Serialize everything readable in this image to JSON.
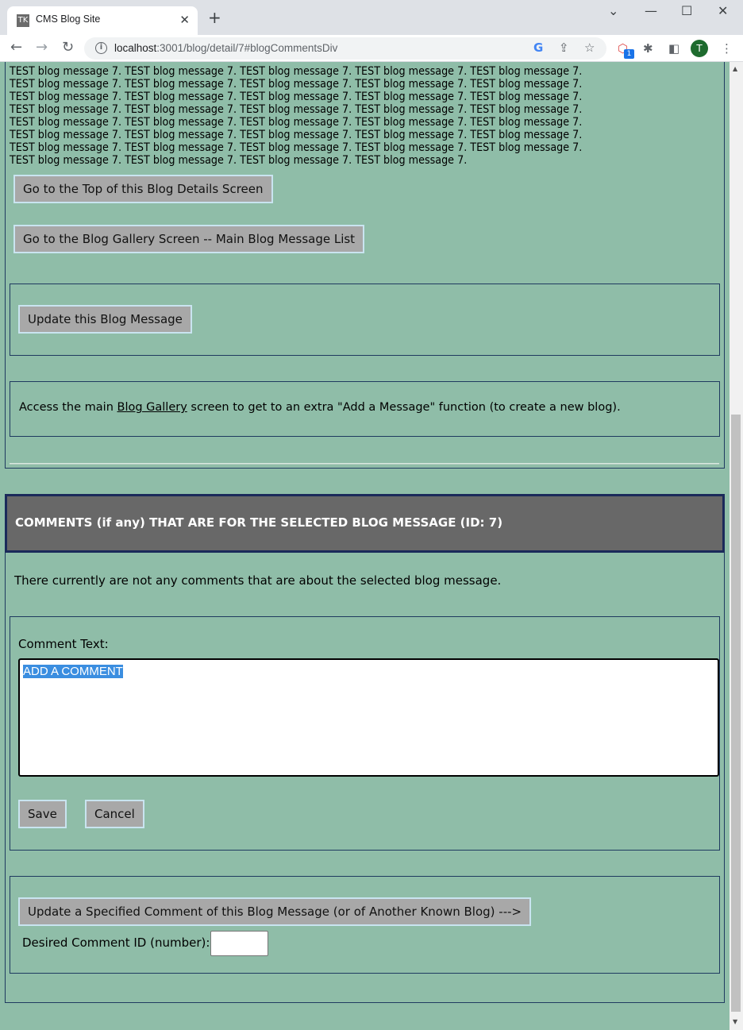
{
  "browser": {
    "tab_title": "CMS Blog Site",
    "favicon_text": "TK",
    "url_host": "localhost",
    "url_rest": ":3001/blog/detail/7#blogCommentsDiv",
    "profile_initial": "T",
    "extension_badge": "1"
  },
  "blog": {
    "message_lines": [
      "TEST blog message 7. TEST blog message 7. TEST blog message 7. TEST blog message 7. TEST blog message 7.",
      "TEST blog message 7. TEST blog message 7. TEST blog message 7. TEST blog message 7. TEST blog message 7.",
      "TEST blog message 7. TEST blog message 7. TEST blog message 7. TEST blog message 7. TEST blog message 7.",
      "TEST blog message 7. TEST blog message 7. TEST blog message 7. TEST blog message 7. TEST blog message 7.",
      "TEST blog message 7. TEST blog message 7. TEST blog message 7. TEST blog message 7. TEST blog message 7.",
      "TEST blog message 7. TEST blog message 7. TEST blog message 7. TEST blog message 7. TEST blog message 7.",
      "TEST blog message 7. TEST blog message 7. TEST blog message 7. TEST blog message 7. TEST blog message 7.",
      "TEST blog message 7. TEST blog message 7. TEST blog message 7. TEST blog message 7."
    ],
    "go_top_label": "Go to the Top of this Blog Details Screen",
    "go_gallery_label": "Go to the Blog Gallery Screen -- Main Blog Message List",
    "update_label": "Update this Blog Message",
    "access_before": "Access the main ",
    "access_link": "Blog Gallery",
    "access_after": " screen to get to an extra \"Add a Message\" function (to create a new blog)."
  },
  "comments": {
    "header": "COMMENTS (if any) THAT ARE FOR THE SELECTED BLOG MESSAGE (ID: 7)",
    "none_text": "There currently are not any comments that are about the selected blog message.",
    "comment_text_label": "Comment Text:",
    "comment_value": "ADD A COMMENT",
    "save_label": "Save",
    "cancel_label": "Cancel",
    "update_specified_label": "Update a Specified Comment of this Blog Message (or of Another Known Blog) --->",
    "desired_id_label": "Desired Comment ID (number):",
    "desired_id_value": ""
  },
  "colors": {
    "page_bg": "#8fbda8",
    "button_bg": "#a8a8a8",
    "header_bg": "#686868",
    "selection": "#3b8ee0"
  }
}
